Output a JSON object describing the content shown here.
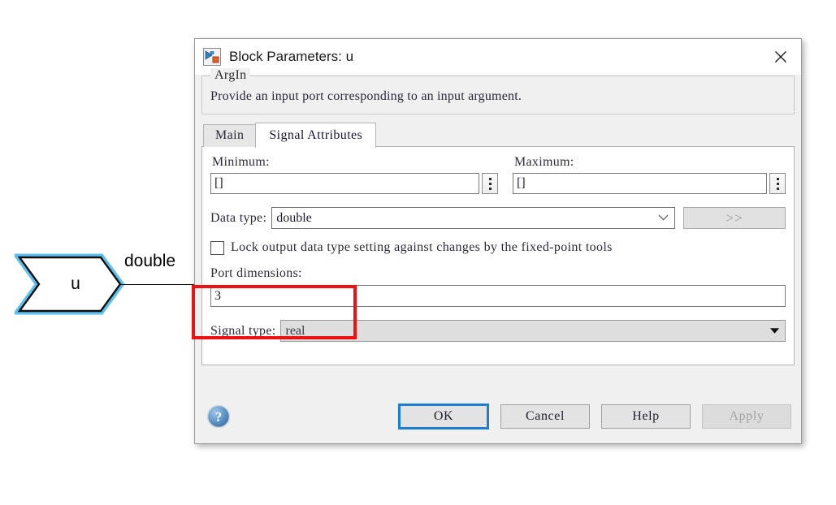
{
  "canvas": {
    "block": {
      "label": "u",
      "shape": "inport-arrow",
      "selected": true,
      "outline_color": "#000000",
      "highlight_color": "#5bc0f0",
      "fill_color": "#ffffff"
    },
    "signal_label": "double"
  },
  "dialog": {
    "title": "Block Parameters: u",
    "title_icon": "simulink-block-icon",
    "close_icon": "close-icon",
    "group": {
      "title": "ArgIn",
      "description": "Provide an input port corresponding to an input argument."
    },
    "tabs": [
      {
        "label": "Main",
        "active": false
      },
      {
        "label": "Signal Attributes",
        "active": true
      }
    ],
    "fields": {
      "minimum": {
        "label": "Minimum:",
        "value": "[]",
        "spinner_icon": "ellipsis-vertical-icon"
      },
      "maximum": {
        "label": "Maximum:",
        "value": "[]",
        "spinner_icon": "ellipsis-vertical-icon"
      },
      "data_type": {
        "label": "Data type:",
        "value": "double",
        "dropdown_icon": "chevron-down-icon",
        "more_button_label": ">>",
        "more_button_enabled": false
      },
      "lock_output": {
        "label": "Lock output data type setting against changes by the fixed-point tools",
        "checked": false
      },
      "port_dimensions": {
        "label": "Port dimensions:",
        "value": "3",
        "highlighted": true,
        "highlight_color": "#ee1111"
      },
      "signal_type": {
        "label": "Signal type:",
        "value": "real",
        "dropdown_icon": "triangle-down-icon",
        "enabled": false
      }
    },
    "footer": {
      "help_icon": "help-circle-icon",
      "buttons": [
        {
          "name": "ok",
          "label": "OK",
          "default": true,
          "enabled": true
        },
        {
          "name": "cancel",
          "label": "Cancel",
          "default": false,
          "enabled": true
        },
        {
          "name": "help",
          "label": "Help",
          "default": false,
          "enabled": true
        },
        {
          "name": "apply",
          "label": "Apply",
          "default": false,
          "enabled": false
        }
      ]
    }
  }
}
